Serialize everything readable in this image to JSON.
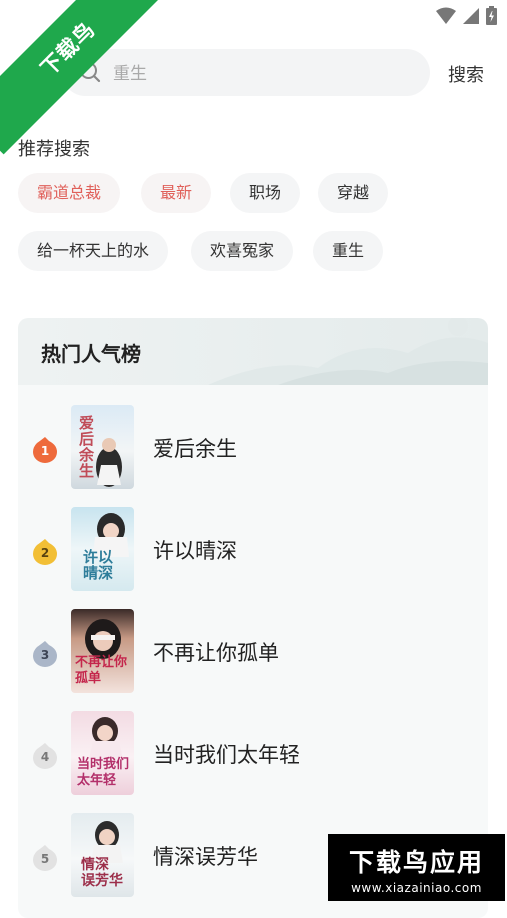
{
  "search": {
    "placeholder": "重生",
    "button_label": "搜索"
  },
  "recommend": {
    "title": "推荐搜索",
    "tags": [
      {
        "label": "霸道总裁",
        "hot": true
      },
      {
        "label": "最新",
        "hot": true
      },
      {
        "label": "职场",
        "hot": false
      },
      {
        "label": "穿越",
        "hot": false
      },
      {
        "label": "给一杯天上的水",
        "hot": false
      },
      {
        "label": "欢喜冤家",
        "hot": false
      },
      {
        "label": "重生",
        "hot": false
      }
    ]
  },
  "ranking": {
    "title": "热门人气榜",
    "items": [
      {
        "rank": "1",
        "title": "爱后余生",
        "cover_text": "爱后余生",
        "badge_color": "#ee6a3c"
      },
      {
        "rank": "2",
        "title": "许以晴深",
        "cover_text": "许以晴深",
        "badge_color": "#f2bf36"
      },
      {
        "rank": "3",
        "title": "不再让你孤单",
        "cover_text": "不再让你孤单",
        "badge_color": "#aab6c8"
      },
      {
        "rank": "4",
        "title": "当时我们太年轻",
        "cover_text": "当时我们太年轻",
        "badge_color": "#e2e2e2"
      },
      {
        "rank": "5",
        "title": "情深误芳华",
        "cover_text": "情深误芳华",
        "badge_color": "#e2e2e2"
      }
    ]
  },
  "watermark": {
    "ribbon": "下载鸟",
    "logo": "下载鸟应用",
    "url": "www.xiazainiao.com"
  },
  "colors": {
    "hot_tag": "#e0605a",
    "ribbon": "#1fa84c"
  }
}
